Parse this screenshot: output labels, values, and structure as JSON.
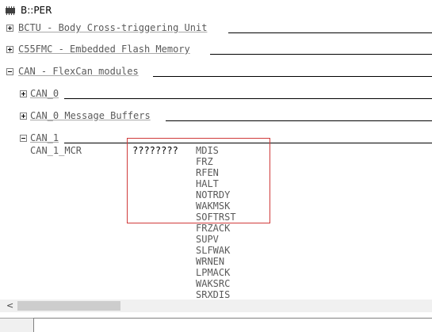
{
  "window": {
    "title": "B::PER"
  },
  "tree": [
    {
      "label": "BCTU - Body Cross-triggering Unit",
      "state": "collapsed"
    },
    {
      "label": "C55FMC - Embedded Flash Memory",
      "state": "collapsed"
    },
    {
      "label": "CAN - FlexCan modules",
      "state": "expanded"
    },
    {
      "label": "CAN_0",
      "state": "collapsed"
    },
    {
      "label": "CAN_0 Message Buffers",
      "state": "collapsed"
    },
    {
      "label": "CAN_1",
      "state": "expanded"
    }
  ],
  "register": {
    "name": "CAN_1_MCR",
    "value": "????????",
    "fields": [
      "MDIS",
      "FRZ",
      "RFEN",
      "HALT",
      "NOTRDY",
      "WAKMSK",
      "SOFTRST",
      "FRZACK",
      "SUPV",
      "SLFWAK",
      "WRNEN",
      "LPMACK",
      "WAKSRC",
      "SRXDIS"
    ]
  },
  "scrollbar": {
    "left_arrow": "<"
  }
}
